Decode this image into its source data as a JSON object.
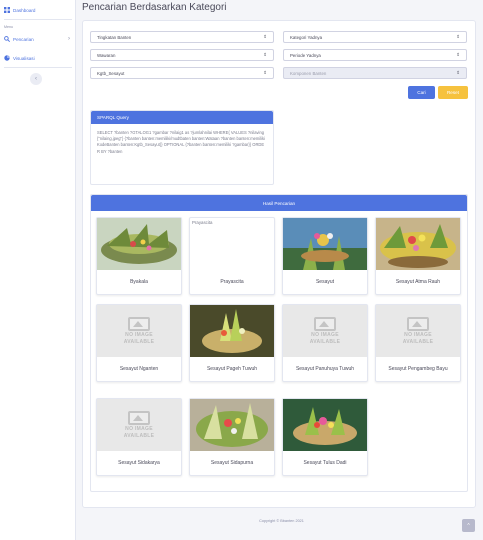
{
  "sidebar": {
    "dashboard_label": "Dashboard",
    "heading": "Menu",
    "pencarian_label": "Pencarian",
    "visualisasi_label": "Visualisasi",
    "toggle_glyph": "‹"
  },
  "page": {
    "title": "Pencarian Berdasarkan Kategori"
  },
  "filters": {
    "tingkatan": "Tingkatan Banten",
    "kategori_yadnya": "Kategori Yadnya",
    "wewaraan": "Wawaran",
    "periode": "Periode Yadnya",
    "kategori_sesayut": "Kgtb_Sesayut",
    "komponen": "Komponen Banten",
    "arrow": "⇕"
  },
  "buttons": {
    "cari": "Cari",
    "reset": "Reset"
  },
  "sparql": {
    "title": "SPARQL Query",
    "query": "SELECT ?banten ?GTALOG1 ?gambar ?nilaig1 as ?jumlahnilai WHERE{ VALUES ?nilaving {\"nilaing.jpeg\"} {?banten banten:memiliki/mudtbaten banten:Wataan ?banten banten:memilikiKodeBanten banten:Kgtb_Sesayut}} OPTIONAL {?banten banten:memiliki ?gambar}} ORDER BY ?banten"
  },
  "hasil": {
    "title": "Hasil Pencarian",
    "no_image_line1": "NO IMAGE",
    "no_image_line2": "AVAILABLE",
    "broken_alt": "Prayascita",
    "items": [
      {
        "name": "Byakala"
      },
      {
        "name": "Prayascita"
      },
      {
        "name": "Sesayut"
      },
      {
        "name": "Sesayut Atma Rauh"
      },
      {
        "name": "Sesayut Nganten"
      },
      {
        "name": "Sesayut Pageh Tuwuh"
      },
      {
        "name": "Sesayut Panuhuya Tuwuh"
      },
      {
        "name": "Sesayut Pengambeg Bayu"
      },
      {
        "name": "Sesayut Sidakarya"
      },
      {
        "name": "Sesayut Sidapurna"
      },
      {
        "name": "Sesayut Tulus Dadi"
      }
    ]
  },
  "footer": {
    "copyright": "Copyright © Bbanten 2021",
    "scroll_glyph": "^"
  },
  "colors": {
    "primary": "#4e73df",
    "warning": "#f6c23e",
    "background": "#f4f5f9"
  }
}
